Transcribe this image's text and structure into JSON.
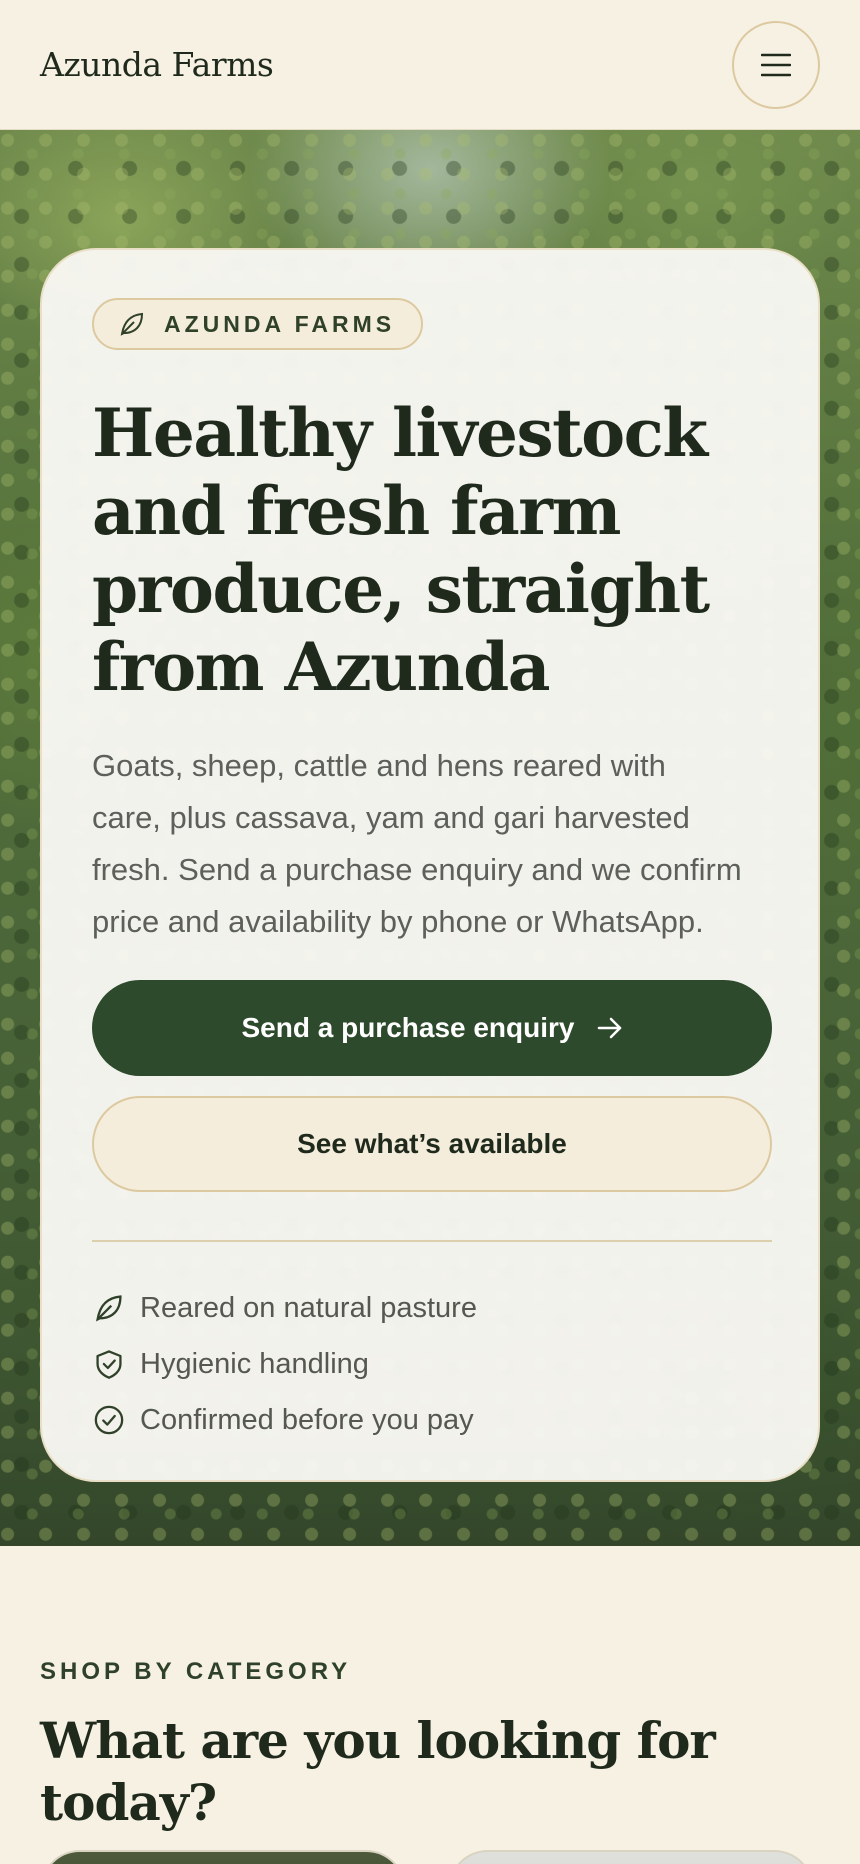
{
  "header": {
    "brand": "Azunda Farms",
    "menu_icon": "hamburger-menu-icon"
  },
  "hero": {
    "badge_icon": "leaf-icon",
    "badge_label": "AZUNDA FARMS",
    "headline": "Healthy livestock and fresh farm produce, straight from Azunda",
    "lede": "Goats, sheep, cattle and hens reared with care, plus cassava, yam and gari harvested fresh. Send a purchase enquiry and we confirm price and availability by phone or WhatsApp.",
    "primary_cta": "Send a purchase enquiry",
    "primary_cta_icon": "arrow-right-icon",
    "secondary_cta": "See what’s available",
    "features": [
      {
        "icon": "leaf-icon",
        "label": "Reared on natural pasture"
      },
      {
        "icon": "shield-check-icon",
        "label": "Hygienic handling"
      },
      {
        "icon": "check-circle-icon",
        "label": "Confirmed before you pay"
      }
    ]
  },
  "categories": {
    "eyebrow": "SHOP BY CATEGORY",
    "title": "What are you looking for today?"
  },
  "colors": {
    "background": "#f6f1e3",
    "primary": "#2e4a2c",
    "accent_border": "#dcc9a0",
    "text": "#1f2a1c"
  }
}
